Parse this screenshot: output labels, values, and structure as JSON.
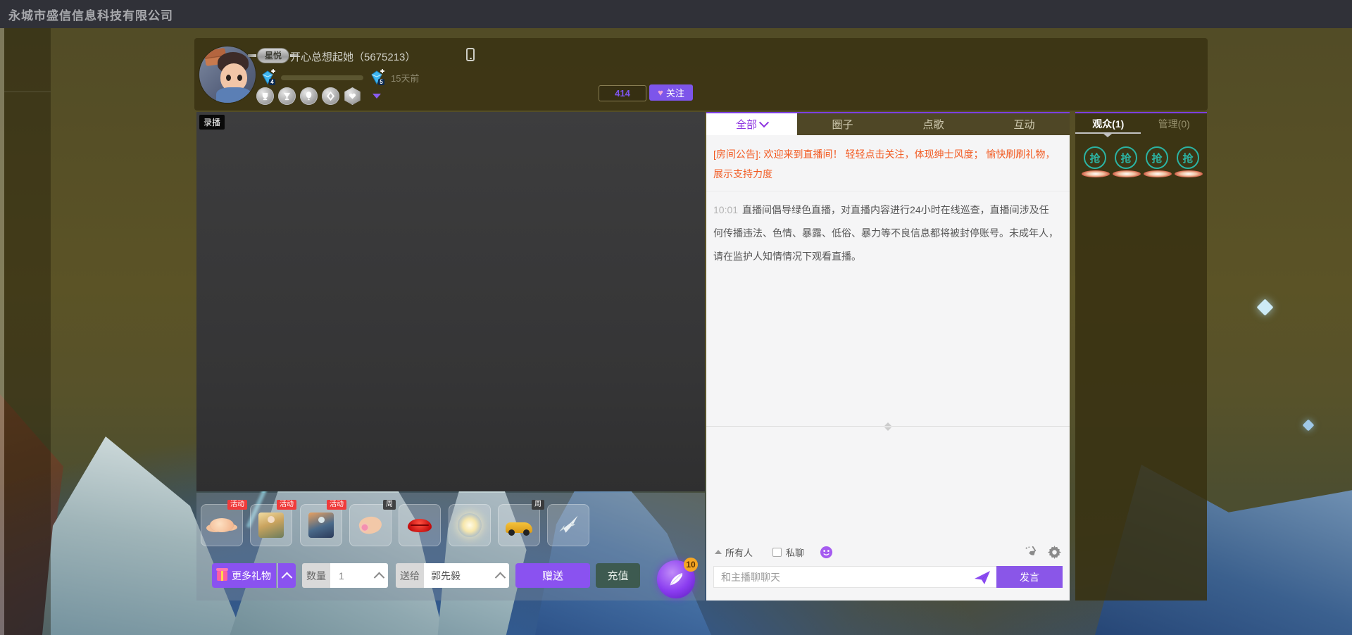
{
  "topbar": {
    "title": "永城市盛信信息科技有限公司"
  },
  "header": {
    "badge": "星悦",
    "streamer_name": "开心总想起她（5675213）",
    "level_current": "4",
    "level_next": "5",
    "days": "15天前",
    "viewer_count": "414",
    "follow_label": "关注",
    "follow_heart": "♥"
  },
  "video": {
    "record_label": "录播"
  },
  "chat": {
    "tabs": [
      {
        "label": "全部"
      },
      {
        "label": "圈子"
      },
      {
        "label": "点歌"
      },
      {
        "label": "互动"
      }
    ],
    "announcement": "[房间公告]: 欢迎来到直播间！ 轻轻点击关注，体现绅士风度； 愉快刷刷礼物，展示支持力度",
    "system_time": "10:01",
    "system_message": "直播间倡导绿色直播，对直播内容进行24小时在线巡查，直播间涉及任何传播违法、色情、暴露、低俗、暴力等不良信息都将被封停账号。未成年人，请在监护人知情情况下观看直播。",
    "audience_label": "所有人",
    "private_label": "私聊",
    "input_placeholder": "和主播聊聊天",
    "send_label": "发言"
  },
  "viewers": {
    "tab_viewers": "观众(1)",
    "tab_admin": "管理(0)",
    "grab_label": "抢"
  },
  "gifts": {
    "items": [
      {
        "name": "peach-cloud",
        "badge": "活动"
      },
      {
        "name": "goddess-card",
        "badge": "活动"
      },
      {
        "name": "character-card",
        "badge": "活动"
      },
      {
        "name": "ring-hand",
        "badge": "周"
      },
      {
        "name": "red-lips",
        "badge": ""
      },
      {
        "name": "glow-flower",
        "badge": ""
      },
      {
        "name": "sports-car",
        "badge": "周"
      },
      {
        "name": "airplane",
        "badge": ""
      }
    ],
    "more_label": "更多礼物",
    "quantity_label": "数量",
    "quantity_value": "1",
    "sendto_label": "送给",
    "sendto_value": "郭先毅",
    "give_label": "赠送",
    "recharge_label": "充值",
    "feather_badge": "10"
  },
  "colors": {
    "accent_purple": "#8a52f0",
    "tab_active_purple": "#8d33e0",
    "follow_purple": "#7d55ea",
    "announce_orange": "#f25a21",
    "recharge_green": "#3d5a50",
    "grab_teal": "#2bb3a3",
    "activity_badge_red": "#f03b3b",
    "topbar_bg": "#303138"
  }
}
